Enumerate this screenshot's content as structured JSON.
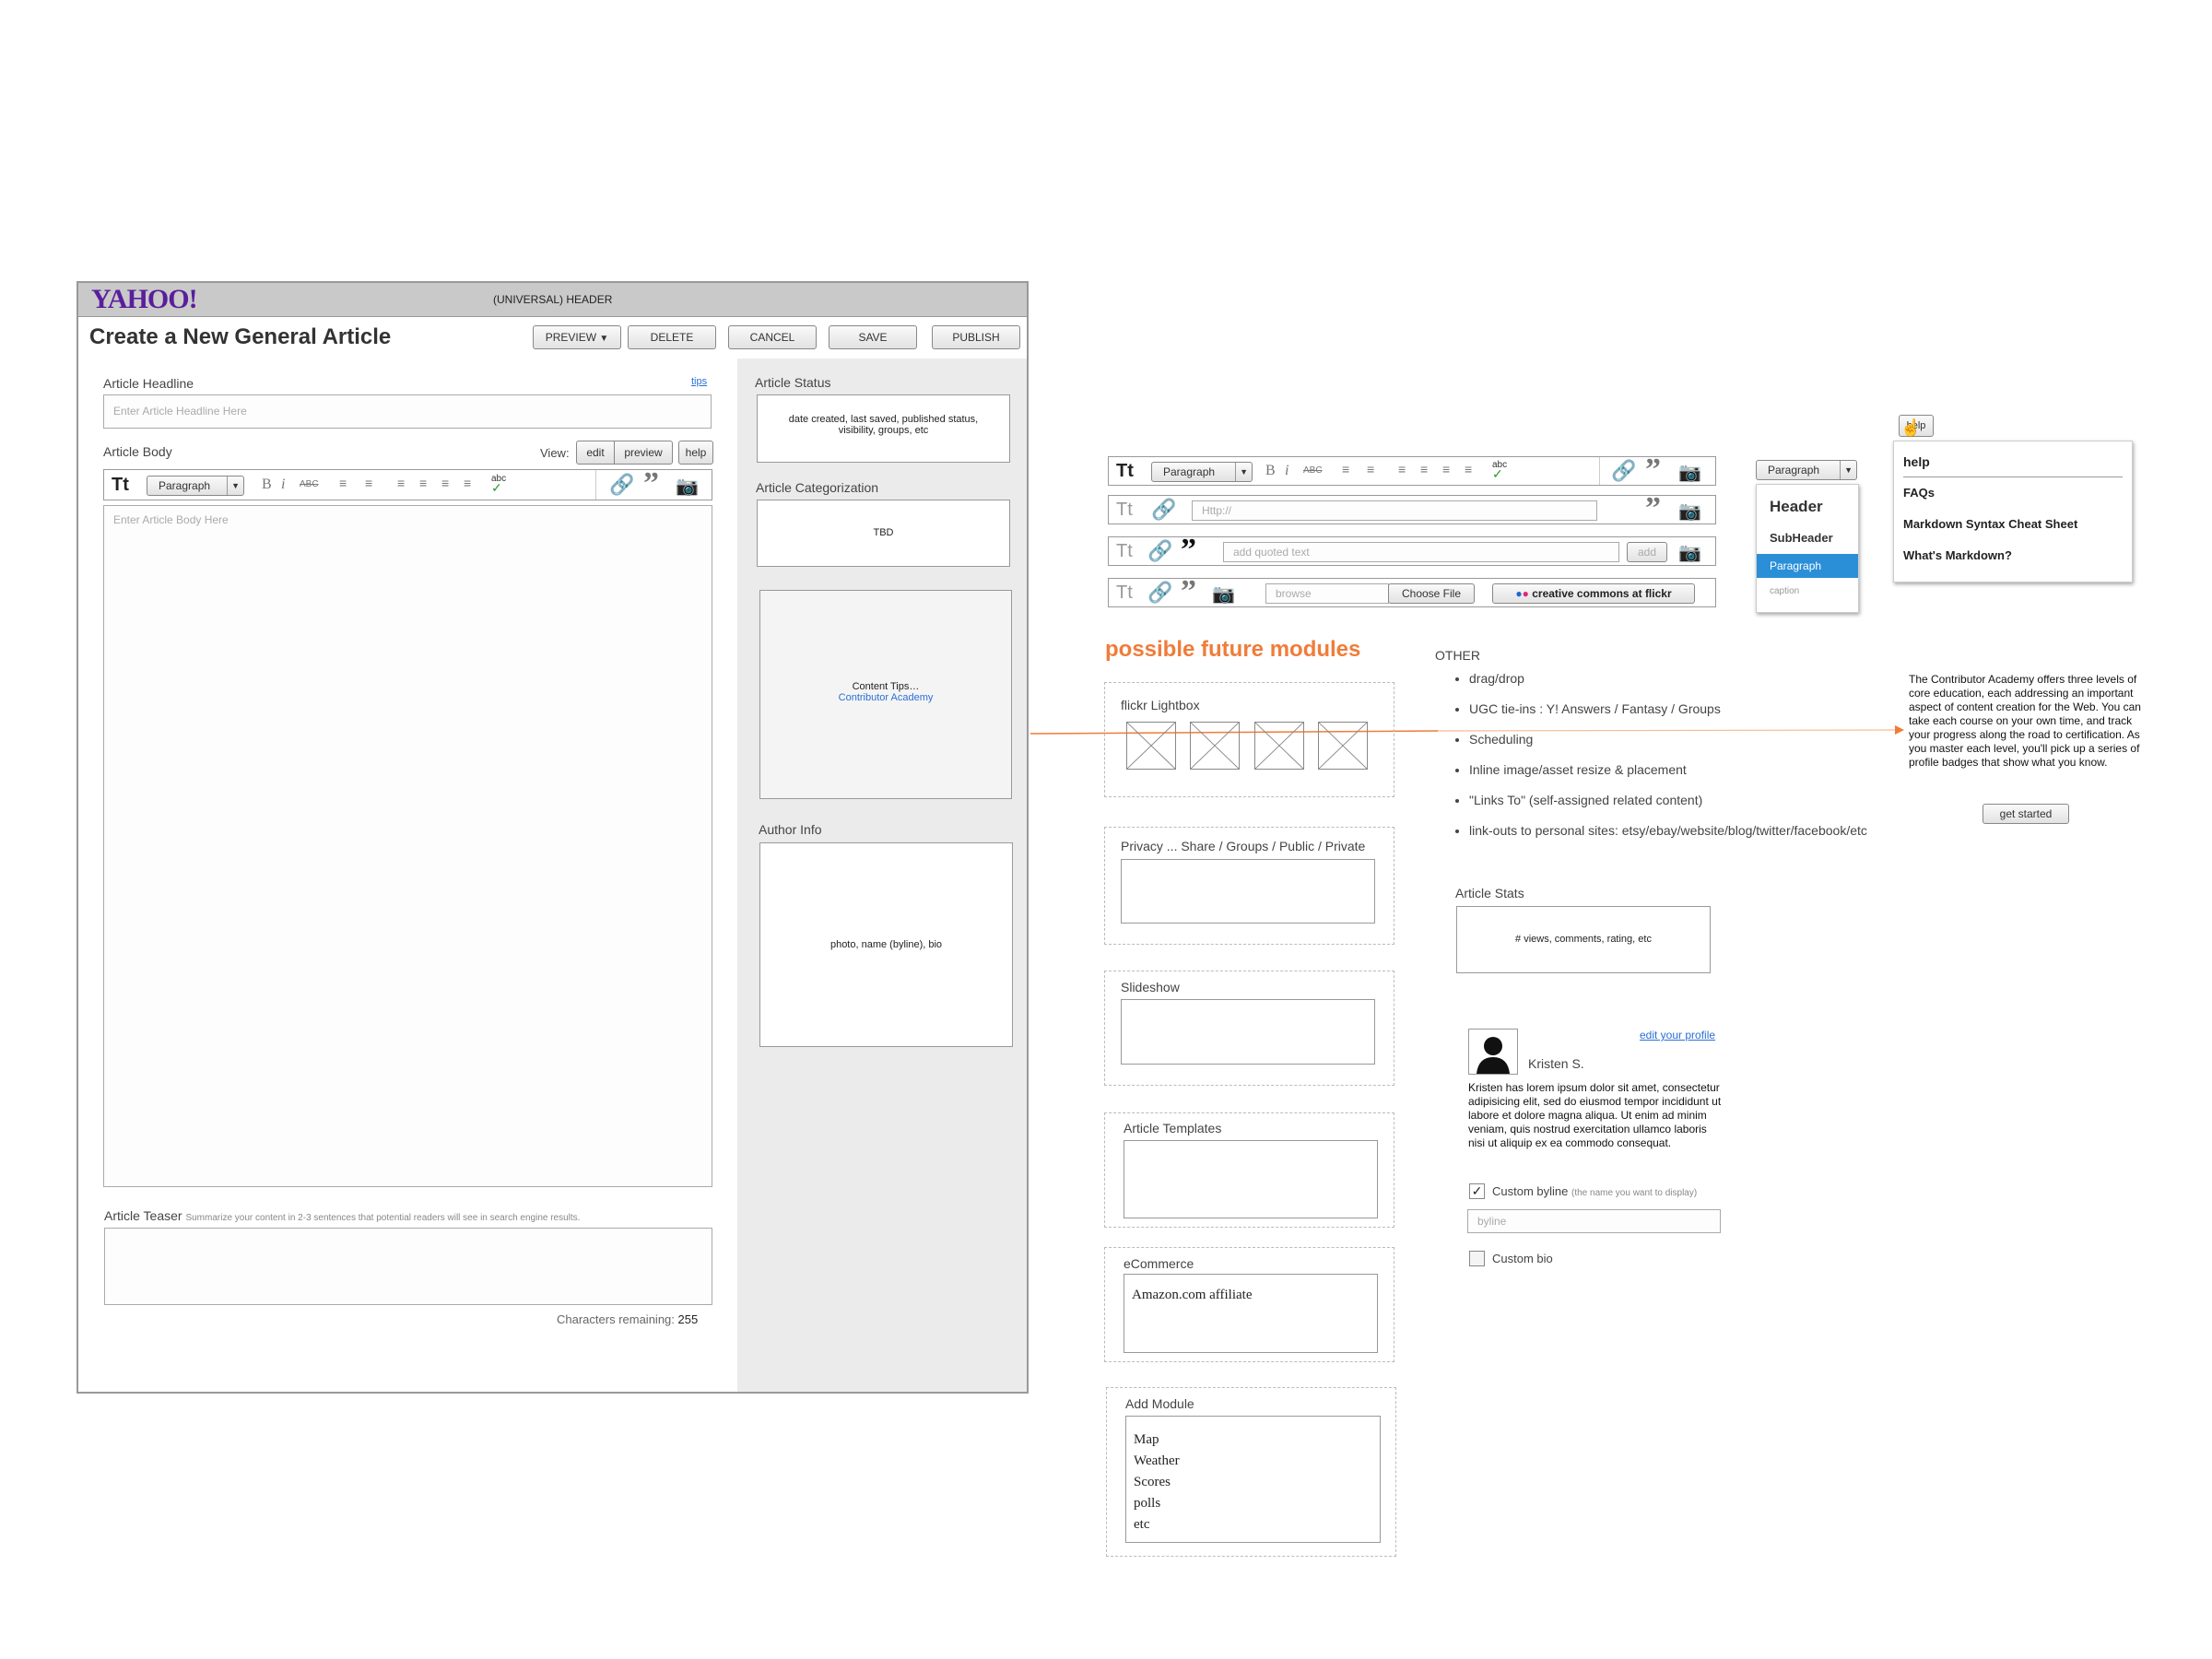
{
  "header": {
    "logo": "YAHOO!",
    "universal_label": "(UNIVERSAL) HEADER"
  },
  "page": {
    "title": "Create a New General Article"
  },
  "actions": {
    "preview": "PREVIEW",
    "delete": "DELETE",
    "cancel": "CANCEL",
    "save": "SAVE",
    "publish": "PUBLISH"
  },
  "headline": {
    "label": "Article Headline",
    "tips": "tips",
    "placeholder": "Enter Article Headline Here"
  },
  "body": {
    "label": "Article Body",
    "view_label": "View:",
    "edit": "edit",
    "preview": "preview",
    "help": "help",
    "placeholder": "Enter Article Body Here"
  },
  "editor": {
    "tt": "Tt",
    "paragraph": "Paragraph",
    "bold": "B",
    "italic": "i",
    "strike": "ABC",
    "spell": "abc"
  },
  "teaser": {
    "label": "Article Teaser",
    "hint": "Summarize your content in 2-3 sentences that potential readers will see in search engine results.",
    "chars_label": "Characters remaining:",
    "chars_value": "255"
  },
  "sidebar": {
    "status_label": "Article Status",
    "status_text": "date created, last saved, published status, visibility, groups, etc",
    "cat_label": "Article Categorization",
    "cat_text": "TBD",
    "tips_text": "Content Tips…",
    "tips_link": "Contributor Academy",
    "author_label": "Author Info",
    "author_text": "photo, name (byline), bio"
  },
  "toolbars": {
    "url_placeholder": "Http://",
    "quote_placeholder": "add quoted text",
    "add": "add",
    "browse": "browse",
    "choose_file": "Choose File",
    "flickr": "creative commons at flickr"
  },
  "format_menu": {
    "selected": "Paragraph",
    "header": "Header",
    "subheader": "SubHeader",
    "paragraph": "Paragraph",
    "caption": "caption"
  },
  "help_menu": {
    "trigger": "help",
    "title": "help",
    "faqs": "FAQs",
    "cheat": "Markdown Syntax Cheat Sheet",
    "what": "What's Markdown?"
  },
  "future": {
    "title": "possible future modules"
  },
  "modules": {
    "lightbox": "flickr Lightbox",
    "privacy": "Privacy ...  Share / Groups / Public / Private",
    "slideshow": "Slideshow",
    "templates": "Article Templates",
    "ecommerce": "eCommerce",
    "ecommerce_text": "Amazon.com affiliate",
    "add": "Add Module",
    "add_items": [
      "Map",
      "Weather",
      "Scores",
      "polls",
      "etc"
    ]
  },
  "other": {
    "title": "OTHER",
    "items": [
      "drag/drop",
      "UGC tie-ins : Y! Answers / Fantasy / Groups",
      "Scheduling",
      "Inline image/asset resize & placement",
      "\"Links To\" (self-assigned related content)",
      "link-outs to personal sites: etsy/ebay/website/blog/twitter/facebook/etc"
    ]
  },
  "academy": {
    "text": "The Contributor Academy offers three levels of core education, each addressing an important aspect of content creation for the Web. You can take each course on your own time, and track your progress along the road to certification. As you master each level, you'll pick up a series of profile badges that show what you know.",
    "button": "get started"
  },
  "stats": {
    "label": "Article Stats",
    "text": "# views, comments, rating, etc"
  },
  "profile": {
    "edit_link": "edit your profile",
    "name": "Kristen S.",
    "bio": "Kristen has lorem ipsum dolor sit amet, consectetur adipisicing elit, sed do eiusmod tempor incididunt ut labore et dolore magna aliqua. Ut enim ad minim veniam, quis nostrud exercitation ullamco laboris nisi ut aliquip ex ea commodo consequat.",
    "byline_label": "Custom byline",
    "byline_hint": "(the name you want to display)",
    "byline_placeholder": "byline",
    "bio_label": "Custom bio"
  },
  "colors": {
    "accent": "#f07c3a",
    "link": "#2a6fd6",
    "selected": "#2b8fd8",
    "logo": "#5a1e9c"
  }
}
